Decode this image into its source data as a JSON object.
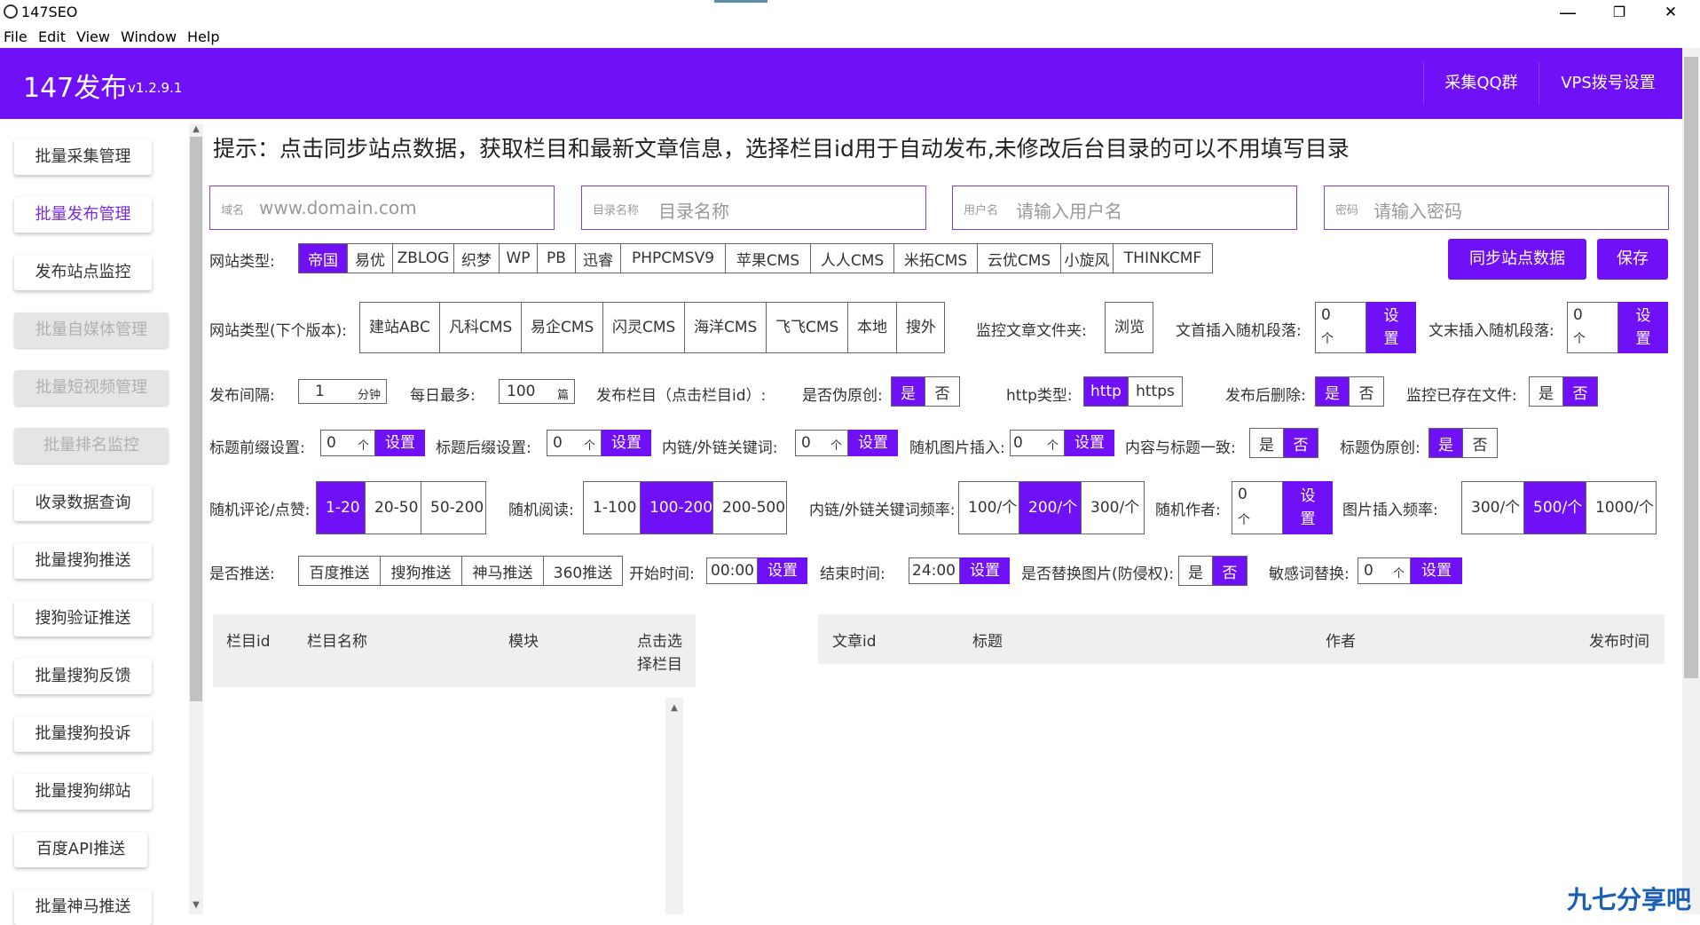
{
  "window": {
    "title": "147SEO",
    "min": "—",
    "max": "❐",
    "close": "✕"
  },
  "menu": [
    "File",
    "Edit",
    "View",
    "Window",
    "Help"
  ],
  "header": {
    "brand": "147发布",
    "version": "v1.2.9.1",
    "btn_qq": "采集QQ群",
    "btn_vps": "VPS拨号设置"
  },
  "sidebar": [
    "批量采集管理",
    "批量发布管理",
    "发布站点监控",
    "批量自媒体管理",
    "批量短视频管理",
    "批量排名监控",
    "收录数据查询",
    "批量搜狗推送",
    "搜狗验证推送",
    "批量搜狗反馈",
    "批量搜狗投诉",
    "批量搜狗绑站",
    "百度API推送",
    "批量神马推送"
  ],
  "tip": "提示：点击同步站点数据，获取栏目和最新文章信息，选择栏目id用于自动发布,未修改后台目录的可以不用填写目录",
  "fields": [
    {
      "label": "域名",
      "placeholder": "www.domain.com"
    },
    {
      "label": "目录名称",
      "placeholder": "目录名称"
    },
    {
      "label": "用户名",
      "placeholder": "请输入用户名"
    },
    {
      "label": "密码",
      "placeholder": "请输入密码"
    }
  ],
  "site_type": {
    "label": "网站类型:",
    "options": [
      "帝国",
      "易优",
      "ZBLOG",
      "织梦",
      "WP",
      "PB",
      "迅睿",
      "PHPCMSV9",
      "苹果CMS",
      "人人CMS",
      "米拓CMS",
      "云优CMS",
      "小旋风",
      "THINKCMF"
    ],
    "selected": "帝国"
  },
  "sync_btn": "同步站点数据",
  "save_btn": "保存",
  "site_type2": {
    "label": "网站类型(下个版本):",
    "options": [
      [
        "建站",
        "ABC"
      ],
      [
        "凡科",
        "CMS"
      ],
      [
        "易企",
        "CMS"
      ],
      [
        "闪灵",
        "CMS"
      ],
      [
        "海洋",
        "CMS"
      ],
      [
        "飞飞",
        "CMS"
      ],
      [
        "本",
        "地"
      ],
      [
        "搜",
        "外"
      ]
    ]
  },
  "monitor_folder": {
    "label": "监控文章文件夹:",
    "btn": [
      "浏",
      "览"
    ]
  },
  "head_insert": {
    "label": "文首插入随机段落:",
    "value": "0",
    "unit": "个",
    "btn": [
      "设",
      "置"
    ]
  },
  "tail_insert": {
    "label": "文末插入随机段落:",
    "value": "0",
    "unit": "个",
    "btn": [
      "设",
      "置"
    ]
  },
  "row4": {
    "interval_label": "发布间隔:",
    "interval_value": "1",
    "interval_unit": "分钟",
    "daily_label": "每日最多:",
    "daily_value": "100",
    "daily_unit": "篇",
    "column_label": "发布栏目（点击栏目id）:",
    "pseudo_label": "是否伪原创:",
    "http_label": "http类型:",
    "http_opts": [
      "http",
      "https"
    ],
    "del_label": "发布后删除:",
    "exist_label": "监控已存在文件:",
    "yes": "是",
    "no": "否"
  },
  "row5": {
    "prefix_label": "标题前缀设置:",
    "suffix_label": "标题后缀设置:",
    "kw_label": "内链/外链关键词:",
    "img_label": "随机图片插入:",
    "consistent_label": "内容与标题一致:",
    "title_pseudo_label": "标题伪原创:",
    "value": "0",
    "unit": "个",
    "set": "设置"
  },
  "row6": {
    "comment_label": "随机评论/点赞:",
    "comment_opts": [
      [
        "1-",
        "20"
      ],
      [
        "20-",
        "50"
      ],
      [
        "50-",
        "200"
      ]
    ],
    "read_label": "随机阅读:",
    "read_opts": [
      [
        "1-",
        "100"
      ],
      [
        "100-",
        "200"
      ],
      [
        "200-",
        "500"
      ]
    ],
    "kwfreq_label": "内链/外链关键词频率:",
    "kwfreq_opts": [
      [
        "100/",
        "个"
      ],
      [
        "200/",
        "个"
      ],
      [
        "300/",
        "个"
      ]
    ],
    "author_label": "随机作者:",
    "author_value": "0",
    "author_unit": "个",
    "author_btn": [
      "设",
      "置"
    ],
    "imgfreq_label": "图片插入频率:",
    "imgfreq_opts": [
      [
        "300/",
        "个"
      ],
      [
        "500/",
        "个"
      ],
      [
        "1000/",
        "个"
      ]
    ]
  },
  "row7": {
    "push_label": "是否推送:",
    "push_opts": [
      "百度推送",
      "搜狗推送",
      "神马推送",
      "360推送"
    ],
    "start_label": "开始时间:",
    "start_value": "00:00",
    "end_label": "结束时间:",
    "end_value": "24:00",
    "replace_label": "是否替换图片(防侵权):",
    "sensitive_label": "敏感词替换:",
    "sensitive_value": "0",
    "sensitive_unit": "个",
    "set": "设置"
  },
  "table_left": {
    "headers": [
      "栏目id",
      "栏目名称",
      "模块",
      "点击选",
      "择栏目"
    ]
  },
  "table_right": {
    "headers": [
      "文章id",
      "标题",
      "作者",
      "发布时间"
    ]
  },
  "watermark": "九七分享吧"
}
